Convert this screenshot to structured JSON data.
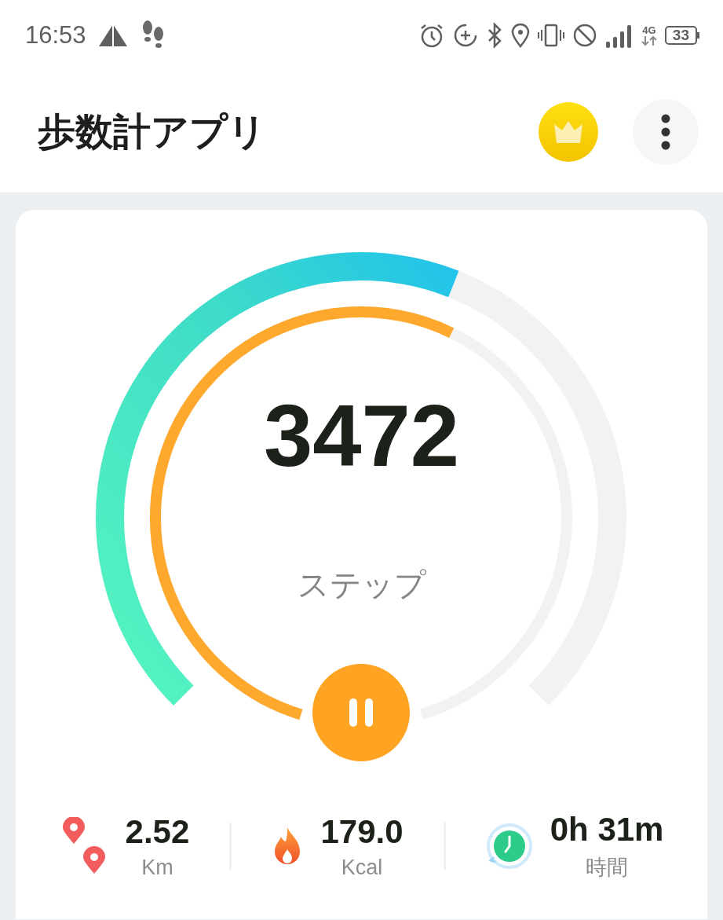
{
  "status_bar": {
    "time": "16:53",
    "network": "4G",
    "battery": "33"
  },
  "app_bar": {
    "title": "歩数計アプリ"
  },
  "gauge": {
    "steps": "3472",
    "unit": "ステップ",
    "running": true
  },
  "stats": [
    {
      "kind": "distance",
      "value": "2.52",
      "unit": "Km"
    },
    {
      "kind": "calories",
      "value": "179.0",
      "unit": "Kcal"
    },
    {
      "kind": "duration",
      "value": "0h 31m",
      "unit": "時間"
    }
  ]
}
